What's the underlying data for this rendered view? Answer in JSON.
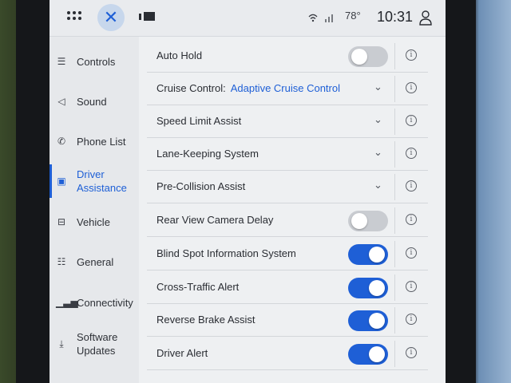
{
  "topbar": {
    "time": "10:31",
    "temperature": "78°",
    "apps_icon": "grid-icon",
    "close_icon": "close-icon",
    "media_icon": "media-icon",
    "user_icon": "user-icon"
  },
  "sidebar": {
    "items": [
      {
        "label": "Controls",
        "icon": "controls-icon"
      },
      {
        "label": "Sound",
        "icon": "speaker-icon"
      },
      {
        "label": "Phone List",
        "icon": "phone-icon"
      },
      {
        "label": "Driver Assistance",
        "line1": "Driver",
        "line2": "Assistance",
        "icon": "driver-assist-icon",
        "active": true
      },
      {
        "label": "Vehicle",
        "icon": "vehicle-icon"
      },
      {
        "label": "General",
        "icon": "sliders-icon"
      },
      {
        "label": "Connectivity",
        "icon": "signal-icon"
      },
      {
        "label": "Software Updates",
        "line1": "Software",
        "line2": "Updates",
        "icon": "download-icon"
      }
    ]
  },
  "settings": [
    {
      "label": "Auto Hold",
      "control": "toggle",
      "state": "off"
    },
    {
      "label": "Cruise Control:",
      "value": "Adaptive Cruise Control",
      "control": "dropdown"
    },
    {
      "label": "Speed Limit Assist",
      "control": "dropdown"
    },
    {
      "label": "Lane-Keeping System",
      "control": "dropdown"
    },
    {
      "label": "Pre-Collision Assist",
      "control": "dropdown"
    },
    {
      "label": "Rear View Camera Delay",
      "control": "toggle",
      "state": "off"
    },
    {
      "label": "Blind Spot Information System",
      "control": "toggle",
      "state": "on"
    },
    {
      "label": "Cross-Traffic Alert",
      "control": "toggle",
      "state": "on"
    },
    {
      "label": "Reverse Brake Assist",
      "control": "toggle",
      "state": "on"
    },
    {
      "label": "Driver Alert",
      "control": "toggle",
      "state": "on"
    }
  ],
  "colors": {
    "accent": "#1e5fd6",
    "toggle_off": "#c9ccd1",
    "background": "#eef0f2"
  }
}
